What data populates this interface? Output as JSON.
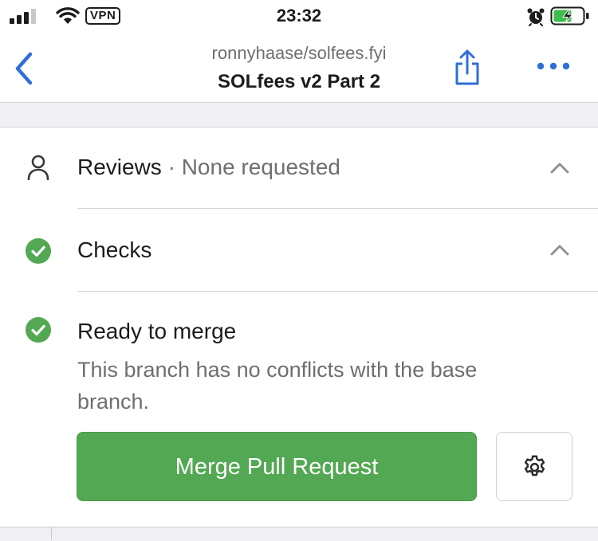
{
  "status_bar": {
    "time": "23:32",
    "vpn_label": "VPN",
    "icons": [
      "signal-icon",
      "wifi-icon",
      "alarm-icon",
      "battery-charging-icon"
    ]
  },
  "nav": {
    "repo": "ronnyhaase/solfees.fyi",
    "title": "SOLfees v2 Part 2",
    "icons": [
      "back-chevron-icon",
      "share-icon",
      "more-icon"
    ]
  },
  "reviews": {
    "label": "Reviews",
    "separator": " · ",
    "status": "None requested",
    "icon": "person-icon"
  },
  "checks": {
    "label": "Checks",
    "icon": "check-circle-icon"
  },
  "merge": {
    "title": "Ready to merge",
    "description": "This branch has no conflicts with the base branch.",
    "button_label": "Merge Pull Request",
    "icon": "gear-icon"
  },
  "colors": {
    "accent_blue": "#2f6fd6",
    "success_green": "#53a853",
    "muted_text": "#6e6e73",
    "separator": "#d1d1d6"
  }
}
